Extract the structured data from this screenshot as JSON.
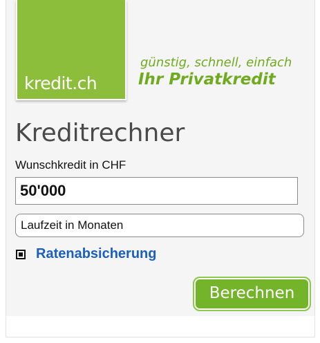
{
  "brand": {
    "logo_text": "kredit.ch",
    "slogan": "günstig, schnell, einfach",
    "tagline": "Ihr Privatkredit",
    "color": "#8cbe3c"
  },
  "calculator": {
    "title": "Kreditrechner",
    "amount_label": "Wunschkredit in CHF",
    "amount_value": "50'000",
    "duration_placeholder": "Laufzeit in Monaten",
    "insurance_label": "Ratenabsicherung",
    "insurance_checked": true,
    "submit_label": "Berechnen"
  }
}
